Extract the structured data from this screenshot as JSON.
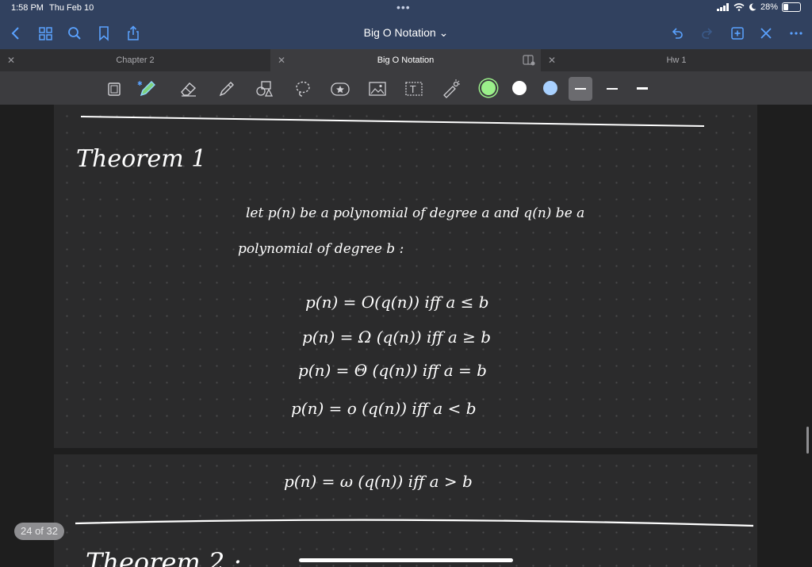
{
  "status": {
    "time": "1:58 PM",
    "date": "Thu Feb 10",
    "battery": "28%",
    "dots": "•••"
  },
  "nav": {
    "title": "Big O Notation ⌄"
  },
  "tabs": [
    {
      "label": "Chapter 2"
    },
    {
      "label": "Big O Notation"
    },
    {
      "label": "Hw 1"
    }
  ],
  "colors": {
    "accent": "#5aa2ff",
    "swatch_green": "#9bf08a",
    "swatch_white": "#ffffff",
    "swatch_blue": "#a9d1ff",
    "nav_bg": "#31415f"
  },
  "icons": [
    "back-icon",
    "thumbnails-icon",
    "search-icon",
    "bookmark-icon",
    "share-icon",
    "undo-icon",
    "redo-icon",
    "add-page-icon",
    "close-icon",
    "more-icon"
  ],
  "notes": {
    "heading": "Theorem 1",
    "line1": "let p(n) be a polynomial of degree a and q(n) be a",
    "line2": "polynomial of degree b :",
    "eq1": "p(n) = O(q(n))  iff   a ≤ b",
    "eq2": "p(n) = Ω (q(n))  iff   a ≥ b",
    "eq3": "p(n) = Θ (q(n))  iff   a = b",
    "eq4": "p(n) = o (q(n))  iff   a < b",
    "eq5": "p(n) = ω (q(n))   iff   a > b",
    "heading2": "Theorem 2 :"
  },
  "pager": {
    "label": "24 of 32"
  }
}
